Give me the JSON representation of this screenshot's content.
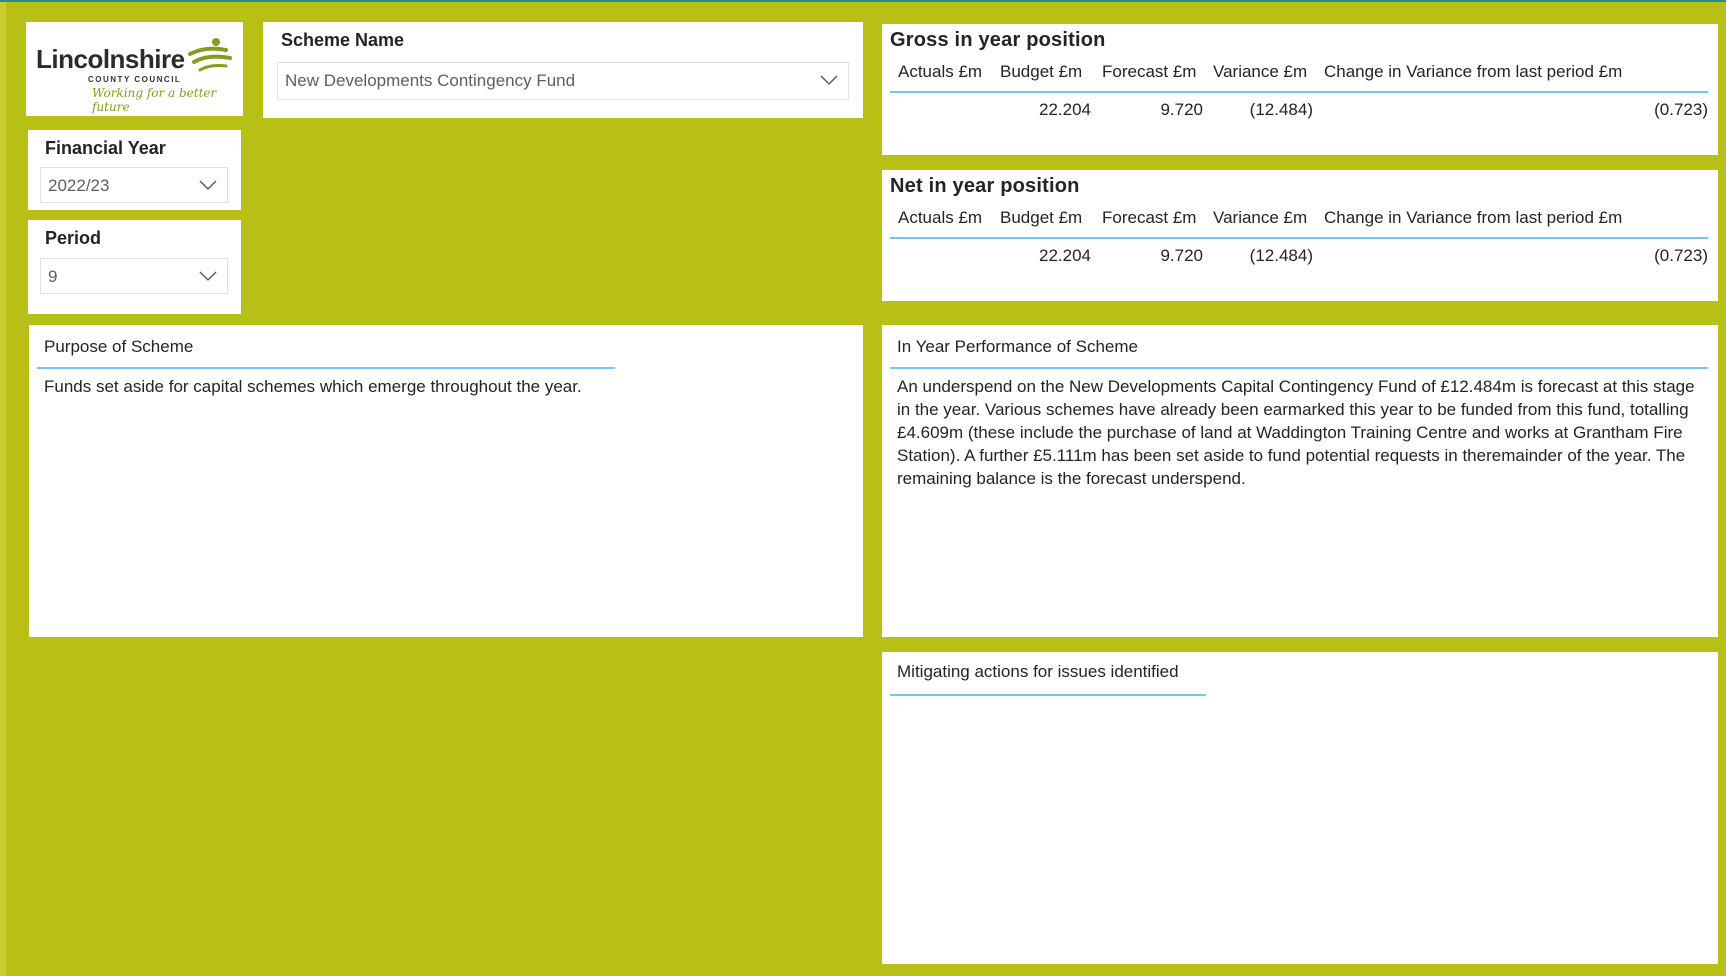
{
  "logo": {
    "main": "Lincolnshire",
    "sub": "COUNTY COUNCIL",
    "tagline": "Working for a better future"
  },
  "scheme_slicer": {
    "title": "Scheme Name",
    "value": "New Developments Contingency Fund"
  },
  "fy_slicer": {
    "title": "Financial Year",
    "value": "2022/23"
  },
  "period_slicer": {
    "title": "Period",
    "value": "9"
  },
  "gross": {
    "title": "Gross in year position",
    "headers": [
      "Actuals £m",
      "Budget £m",
      "Forecast £m",
      "Variance £m",
      "Change in Variance from last period £m"
    ],
    "row": [
      "",
      "22.204",
      "9.720",
      "(12.484)",
      "(0.723)"
    ]
  },
  "net": {
    "title": "Net in year position",
    "headers": [
      "Actuals £m",
      "Budget £m",
      "Forecast £m",
      "Variance £m",
      "Change in Variance from last period £m"
    ],
    "row": [
      "",
      "22.204",
      "9.720",
      "(12.484)",
      "(0.723)"
    ]
  },
  "purpose": {
    "title": "Purpose of Scheme",
    "text": "Funds set aside for capital schemes which emerge throughout the year."
  },
  "performance": {
    "title": "In Year Performance of Scheme",
    "text": "An underspend on the New Developments Capital Contingency Fund of £12.484m is forecast at this stage in the year. Various schemes have already been earmarked this year to be funded from this fund, totalling £4.609m (these include the purchase of land at Waddington Training Centre and works at Grantham Fire Station). A further £5.111m has been set aside to fund potential requests in theremainder of the year. The remaining balance is the forecast underspend."
  },
  "mitigating": {
    "title": "Mitigating actions for issues identified",
    "text": ""
  },
  "colors": {
    "background": "#B9C015",
    "accent_line": "#7cc4f0",
    "logo_green": "#8a9a1c"
  },
  "icons": {
    "dropdown": "chevron-down-icon",
    "logo": "figure-logo-icon"
  }
}
